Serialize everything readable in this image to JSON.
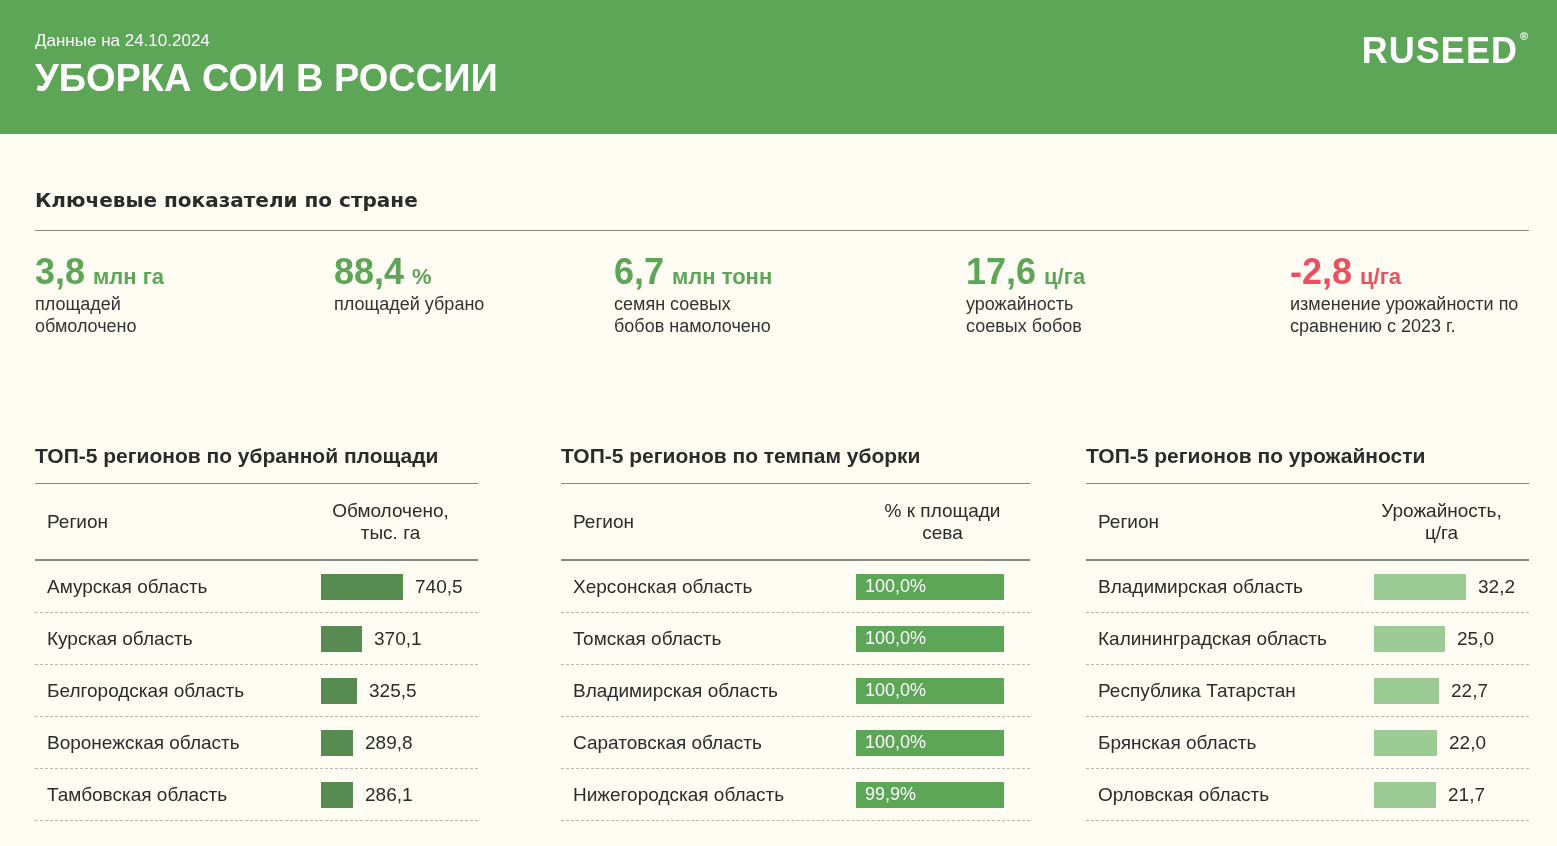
{
  "header": {
    "date": "Данные на 24.10.2024",
    "title": "УБОРКА СОИ В РОССИИ",
    "logo": "RUSEED",
    "logo_mark": "®"
  },
  "key_section": {
    "title": "Ключевые показатели по стране",
    "metrics": [
      {
        "value": "3,8",
        "unit": "млн га",
        "caption": "площадей обмолочено",
        "kind": "positive"
      },
      {
        "value": "88,4",
        "unit": "%",
        "caption": "площадей убрано",
        "kind": "positive"
      },
      {
        "value": "6,7",
        "unit": "млн тонн",
        "caption": "семян соевых бобов намолочено",
        "kind": "positive"
      },
      {
        "value": "17,6",
        "unit": "ц/га",
        "caption": "урожайность соевых бобов",
        "kind": "positive"
      },
      {
        "value": "-2,8",
        "unit": "ц/га",
        "caption": "изменение урожайности по сравнению с 2023 г.",
        "kind": "negative"
      }
    ]
  },
  "tables": [
    {
      "title": "ТОП-5 регионов по убранной площади",
      "columns": [
        "Регион",
        "Обмолочено, тыс. га"
      ],
      "kind": "outside",
      "color": "#578b52",
      "rows": [
        {
          "region": "Амурская область",
          "value": "740,5"
        },
        {
          "region": "Курская область",
          "value": "370,1"
        },
        {
          "region": "Белгородская область",
          "value": "325,5"
        },
        {
          "region": "Воронежская область",
          "value": "289,8"
        },
        {
          "region": "Тамбовская область",
          "value": "286,1"
        }
      ]
    },
    {
      "title": "ТОП-5 регионов по темпам уборки",
      "columns": [
        "Регион",
        "% к площади сева"
      ],
      "kind": "inside",
      "color": "#5da658",
      "rows": [
        {
          "region": "Херсонская область",
          "value": "100,0%"
        },
        {
          "region": "Томская область",
          "value": "100,0%"
        },
        {
          "region": "Владимирская область",
          "value": "100,0%"
        },
        {
          "region": "Саратовская область",
          "value": "100,0%"
        },
        {
          "region": "Нижегородская область",
          "value": "99,9%"
        }
      ]
    },
    {
      "title": "ТОП-5 регионов по урожайности",
      "columns": [
        "Регион",
        "Урожайность, ц/га"
      ],
      "kind": "outside",
      "color": "#9dcb96",
      "rows": [
        {
          "region": "Владимирская область",
          "value": "32,2"
        },
        {
          "region": "Калининградская область",
          "value": "25,0"
        },
        {
          "region": "Республика Татарстан",
          "value": "22,7"
        },
        {
          "region": "Брянская область",
          "value": "22,0"
        },
        {
          "region": "Орловская область",
          "value": "21,7"
        }
      ]
    }
  ]
}
